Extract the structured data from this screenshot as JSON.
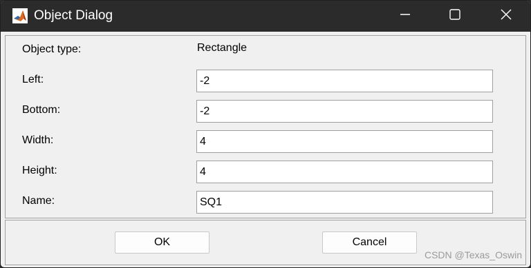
{
  "window": {
    "title": "Object Dialog",
    "app_icon": "matlab-logo-icon"
  },
  "controls": {
    "minimize_icon": "minimize-icon",
    "maximize_icon": "maximize-icon",
    "close_icon": "close-icon"
  },
  "form": {
    "object_type_label": "Object type:",
    "object_type_value": "Rectangle",
    "fields": [
      {
        "label": "Left:",
        "value": "-2"
      },
      {
        "label": "Bottom:",
        "value": "-2"
      },
      {
        "label": "Width:",
        "value": "4"
      },
      {
        "label": "Height:",
        "value": "4"
      },
      {
        "label": "Name:",
        "value": "SQ1"
      }
    ]
  },
  "buttons": {
    "ok_label": "OK",
    "cancel_label": "Cancel"
  },
  "watermark": "CSDN @Texas_Oswin",
  "colors": {
    "titlebar": "#2b2b2b",
    "dialog_background": "#f0f0f0",
    "field_border": "#9e9e9e"
  }
}
